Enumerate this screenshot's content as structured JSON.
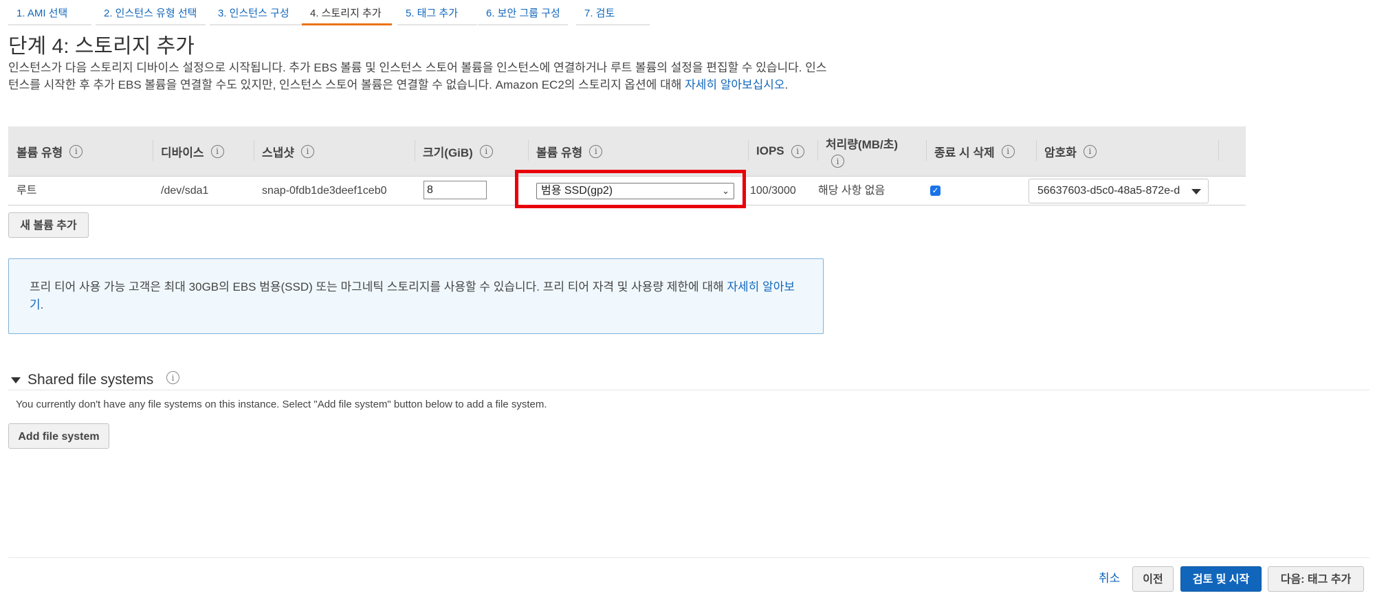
{
  "wizard": {
    "steps": [
      {
        "label": "1. AMI 선택"
      },
      {
        "label": "2. 인스턴스 유형 선택"
      },
      {
        "label": "3. 인스턴스 구성"
      },
      {
        "label": "4. 스토리지 추가"
      },
      {
        "label": "5. 태그 추가"
      },
      {
        "label": "6. 보안 그룹 구성"
      },
      {
        "label": "7. 검토"
      }
    ],
    "active_step": 3
  },
  "page": {
    "title": "단계 4: 스토리지 추가",
    "description": "인스턴스가 다음 스토리지 디바이스 설정으로 시작됩니다. 추가 EBS 볼륨 및 인스턴스 스토어 볼륨을 인스턴스에 연결하거나 루트 볼륨의 설정을 편집할 수 있습니다. 인스턴스를 시작한 후 추가 EBS 볼륨을 연결할 수도 있지만, 인스턴스 스토어 볼륨은 연결할 수 없습니다. Amazon EC2의 스토리지 옵션에 대해 ",
    "description_link": "자세히 알아보십시오",
    "description_end": "."
  },
  "table": {
    "headers": {
      "volume_type": "볼륨 유형",
      "device": "디바이스",
      "snapshot": "스냅샷",
      "size": "크기(GiB)",
      "ebs_type": "볼륨 유형",
      "iops": "IOPS",
      "throughput": "처리량(MB/초)",
      "delete_on_termination": "종료 시 삭제",
      "encryption": "암호화"
    },
    "rows": [
      {
        "volume_type": "루트",
        "device": "/dev/sda1",
        "snapshot": "snap-0fdb1de3deef1ceb0",
        "size": "8",
        "ebs_type": "범용 SSD(gp2)",
        "iops": "100/3000",
        "throughput": "해당 사항 없음",
        "delete_on_termination": true,
        "encryption": "56637603-d5c0-48a5-872e-d"
      }
    ]
  },
  "buttons": {
    "add_volume": "새 볼륨 추가",
    "add_file_system": "Add file system",
    "cancel": "취소",
    "previous": "이전",
    "review_launch": "검토 및 시작",
    "next": "다음: 태그 추가"
  },
  "free_tier": {
    "text": "프리 티어 사용 가능 고객은 최대 30GB의 EBS 범용(SSD) 또는 마그네틱 스토리지를 사용할 수 있습니다. 프리 티어 자격 및 사용량 제한에 대해 ",
    "link": "자세히 알아보기",
    "end": "."
  },
  "shared_fs": {
    "title": "Shared file systems",
    "message": "You currently don't have any file systems on this instance. Select \"Add file system\" button below to add a file system."
  },
  "colors": {
    "accent": "#1166bb",
    "active_tab": "#ec7211",
    "highlight": "#e8000b",
    "info_bg": "#f0f8fd"
  }
}
